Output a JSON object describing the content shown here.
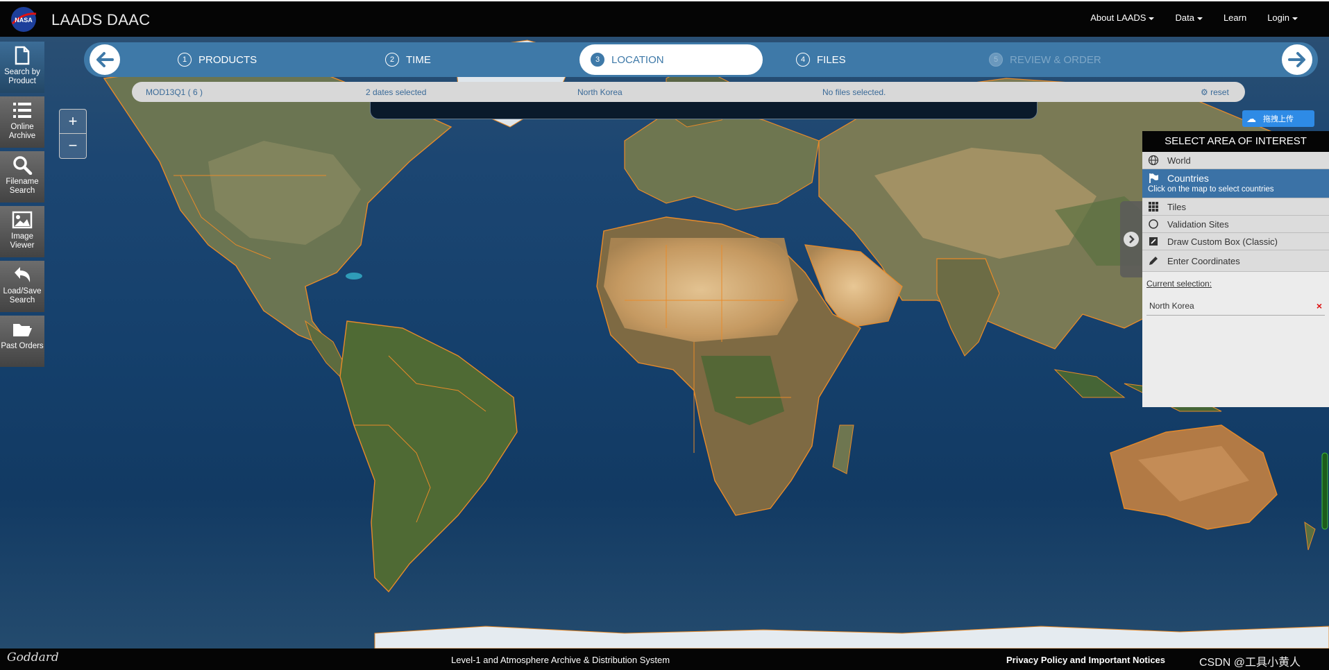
{
  "header": {
    "app_title": "LAADS DAAC",
    "logo_text": "NASA",
    "nav": [
      {
        "label": "About LAADS",
        "dropdown": true
      },
      {
        "label": "Data",
        "dropdown": true
      },
      {
        "label": "Learn",
        "dropdown": false
      },
      {
        "label": "Login",
        "dropdown": true
      }
    ]
  },
  "wizard": {
    "steps": [
      {
        "num": "1",
        "label": "PRODUCTS",
        "state": "done"
      },
      {
        "num": "2",
        "label": "TIME",
        "state": "done"
      },
      {
        "num": "3",
        "label": "LOCATION",
        "state": "active"
      },
      {
        "num": "4",
        "label": "FILES",
        "state": "pending"
      },
      {
        "num": "5",
        "label": "REVIEW & ORDER",
        "state": "disabled"
      }
    ]
  },
  "summary": {
    "product": "MOD13Q1 ( 6 )",
    "dates": "2 dates selected",
    "location": "North Korea",
    "files": "No files selected.",
    "reset": "reset"
  },
  "sidebar": [
    {
      "line1": "Search by",
      "line2": "Product",
      "icon": "document-icon"
    },
    {
      "line1": "Online",
      "line2": "Archive",
      "icon": "list-icon"
    },
    {
      "line1": "Filename",
      "line2": "Search",
      "icon": "search-icon"
    },
    {
      "line1": "Image",
      "line2": "Viewer",
      "icon": "image-icon"
    },
    {
      "line1": "Load/Save",
      "line2": "Search",
      "icon": "undo-icon"
    },
    {
      "line1": "Past Orders",
      "line2": "",
      "icon": "folder-icon"
    }
  ],
  "zoom": {
    "in": "+",
    "out": "−"
  },
  "aoi_panel": {
    "title": "SELECT AREA OF INTEREST",
    "options": [
      {
        "label": "World",
        "icon": "globe-icon"
      },
      {
        "label": "Countries",
        "icon": "flag-icon",
        "hint": "Click on the map to select countries",
        "active": true
      },
      {
        "label": "Tiles",
        "icon": "grid-icon"
      },
      {
        "label": "Validation Sites",
        "icon": "circle-icon"
      },
      {
        "label": "Draw Custom Box (Classic)",
        "icon": "edit-box-icon"
      },
      {
        "label": "Enter Coordinates",
        "icon": "pencil-icon"
      }
    ],
    "current_selection_label": "Current selection:",
    "current_selection_value": "North Korea",
    "remove_symbol": "×"
  },
  "upload_widget": {
    "label": "拖拽上传"
  },
  "footer": {
    "logo_text": "Goddard",
    "center": "Level-1 and Atmosphere Archive & Distribution System",
    "privacy": "Privacy Policy and Important Notices",
    "watermark": "CSDN @工具小黄人"
  },
  "colors": {
    "accent_blue": "#3e79a8",
    "border_orange": "#e88b2a",
    "ocean": "#15406c",
    "header_black": "#050505"
  }
}
